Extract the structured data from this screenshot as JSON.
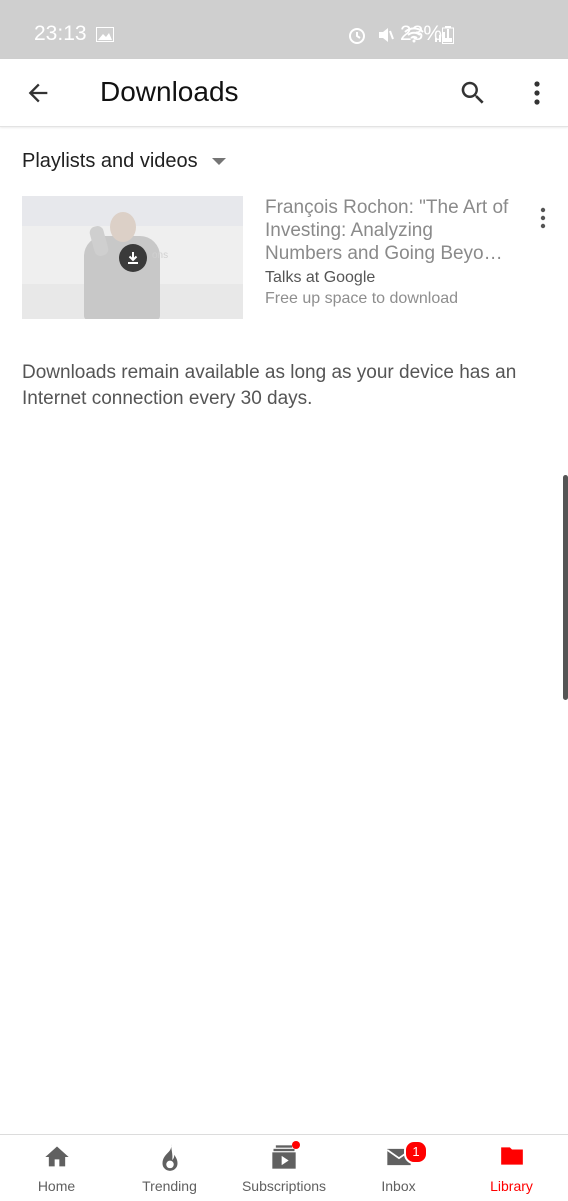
{
  "status_bar": {
    "time": "23:13",
    "battery": "23%"
  },
  "app_bar": {
    "title": "Downloads"
  },
  "filter": {
    "label": "Playlists and videos"
  },
  "video": {
    "title": "François Rochon: \"The Art of Investing: Analyzing Numbers and Going Beyo…",
    "channel": "Talks at Google",
    "status": "Free up space to download",
    "thumb_sign": "ons"
  },
  "note": "Downloads remain available as long as your device has an Internet connection every 30 days.",
  "bottom_nav": {
    "items": [
      {
        "label": "Home",
        "icon": "home-icon"
      },
      {
        "label": "Trending",
        "icon": "flame-icon"
      },
      {
        "label": "Subscriptions",
        "icon": "subscriptions-icon"
      },
      {
        "label": "Inbox",
        "icon": "mail-icon",
        "badge": "1"
      },
      {
        "label": "Library",
        "icon": "folder-icon",
        "active": true
      }
    ]
  },
  "colors": {
    "accent": "#ff0000",
    "statusbar": "#cfcfcf"
  }
}
